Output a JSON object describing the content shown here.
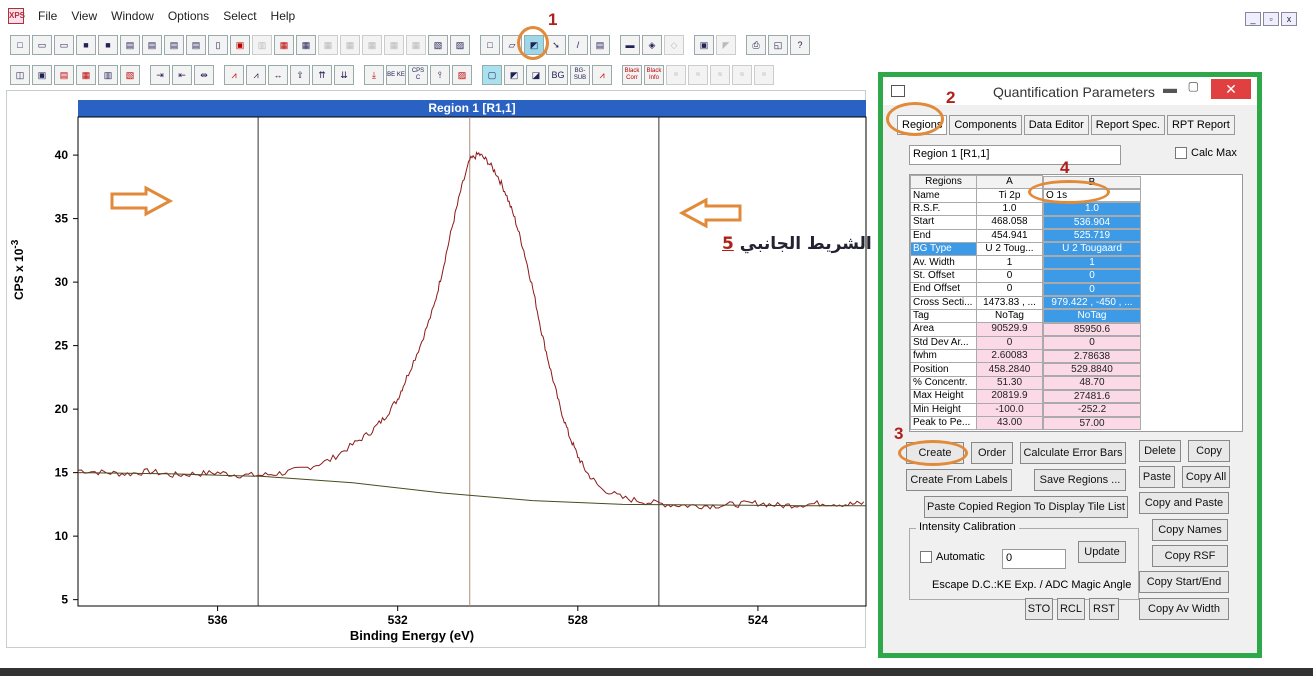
{
  "menu": [
    "File",
    "View",
    "Window",
    "Options",
    "Select",
    "Help"
  ],
  "app_icon_label": "XPS",
  "window_buttons": [
    "_",
    "▫",
    "x"
  ],
  "toolbar_badges": {
    "bk_cor": "Black Corr",
    "bk_info": "Black Info",
    "be": "BE KE",
    "cps": "CPS C",
    "bg_sub": "BG- SUB",
    "bg": "BG"
  },
  "annotations": {
    "n1": "1",
    "n2": "2",
    "n3": "3",
    "n4": "4",
    "n5": "5",
    "arabic_label": "الشريط الجانبي"
  },
  "plot": {
    "title": "Region 1 [R1,1]",
    "xlabel": "Binding Energy (eV)",
    "ylabel": "CPS x 10",
    "ylabel_exp": "-3"
  },
  "chart_data": {
    "type": "line",
    "title": "Region 1 [R1,1]",
    "xlabel": "Binding Energy (eV)",
    "ylabel": "CPS x 10-3",
    "xlim": [
      539.1,
      521.6
    ],
    "ylim": [
      4.5,
      43
    ],
    "x_ticks": [
      536,
      532,
      528,
      524
    ],
    "y_ticks": [
      5,
      10,
      15,
      20,
      25,
      30,
      35,
      40
    ],
    "region_lines": [
      535.1,
      530.4,
      526.2
    ],
    "series": [
      {
        "values_x": [
          539.1,
          538.5,
          538,
          537.5,
          537,
          536.5,
          536,
          535.5,
          535,
          534.5,
          534,
          533.5,
          533,
          532.6,
          532.3,
          532,
          531.8,
          531.5,
          531.2,
          531,
          530.8,
          530.6,
          530.4,
          530.2,
          530,
          529.8,
          529.6,
          529.4,
          529.2,
          529,
          528.8,
          528.6,
          528.4,
          528.2,
          528,
          527.8,
          527.5,
          527,
          526.5,
          526,
          525.5,
          525,
          524.5,
          524,
          523.5,
          523,
          522.5,
          522,
          521.6
        ],
        "values_y": [
          15.2,
          15.0,
          14.9,
          15.1,
          14.8,
          14.9,
          15.0,
          14.8,
          14.8,
          15.0,
          15.4,
          16.0,
          17.2,
          18.2,
          19.3,
          20.8,
          22.5,
          25.0,
          28.0,
          31.0,
          34.2,
          37.2,
          39.6,
          40.1,
          39.5,
          38.5,
          37.0,
          35.0,
          32.5,
          29.5,
          26.0,
          23.0,
          20.2,
          18.0,
          16.3,
          15.0,
          13.8,
          13.0,
          12.7,
          12.5,
          12.4,
          12.4,
          12.5,
          12.6,
          12.4,
          12.5,
          12.6,
          12.5,
          12.6
        ]
      },
      {
        "values_x": [
          539.1,
          537,
          535,
          533,
          531,
          529,
          527,
          525,
          523,
          521.6
        ],
        "values_y": [
          15.0,
          14.9,
          14.7,
          14.2,
          13.4,
          12.8,
          12.5,
          12.45,
          12.4,
          12.4
        ]
      }
    ]
  },
  "dialog": {
    "title": "Quantification Parameters",
    "tabs": [
      "Regions",
      "Components",
      "Data Editor",
      "Report Spec.",
      "RPT Report"
    ],
    "region_name": "Region 1 [R1,1]",
    "calc_max": "Calc Max",
    "table": {
      "headers": [
        "Regions",
        "A",
        "B"
      ],
      "rows": [
        {
          "label": "Name",
          "a": "Ti 2p",
          "b": "O 1s"
        },
        {
          "label": "R.S.F.",
          "a": "1.0",
          "b": "1.0"
        },
        {
          "label": "Start",
          "a": "468.058",
          "b": "536.904"
        },
        {
          "label": "End",
          "a": "454.941",
          "b": "525.719"
        },
        {
          "label": "BG Type",
          "a": "U 2 Toug...",
          "b": "U 2 Tougaard"
        },
        {
          "label": "Av. Width",
          "a": "1",
          "b": "1"
        },
        {
          "label": "St. Offset",
          "a": "0",
          "b": "0"
        },
        {
          "label": "End Offset",
          "a": "0",
          "b": "0"
        },
        {
          "label": "Cross Secti...",
          "a": "1473.83 , ...",
          "b": "979.422 , -450 , ..."
        },
        {
          "label": "Tag",
          "a": "NoTag",
          "b": "NoTag"
        },
        {
          "label": "Area",
          "a": "90529.9",
          "b": "85950.6"
        },
        {
          "label": "Std Dev Ar...",
          "a": "0",
          "b": "0"
        },
        {
          "label": "fwhm",
          "a": "2.60083",
          "b": "2.78638"
        },
        {
          "label": "Position",
          "a": "458.2840",
          "b": "529.8840"
        },
        {
          "label": "% Concentr.",
          "a": "51.30",
          "b": "48.70"
        },
        {
          "label": "Max Height",
          "a": "20819.9",
          "b": "27481.6"
        },
        {
          "label": "Min Height",
          "a": "-100.0",
          "b": "-252.2"
        },
        {
          "label": "Peak to Pe...",
          "a": "43.00",
          "b": "57.00"
        }
      ]
    },
    "buttons": {
      "create": "Create",
      "order": "Order",
      "calc_err": "Calculate Error Bars",
      "delete": "Delete",
      "copy": "Copy",
      "create_labels": "Create From Labels",
      "save_regions": "Save Regions ...",
      "paste": "Paste",
      "copy_all": "Copy All",
      "paste_copied": "Paste Copied Region To Display Tile List",
      "copy_paste": "Copy and Paste",
      "copy_names": "Copy Names",
      "copy_rsf": "Copy RSF",
      "copy_start_end": "Copy Start/End",
      "copy_av_width": "Copy Av Width",
      "sto": "STO",
      "rcl": "RCL",
      "rst": "RST",
      "update": "Update"
    },
    "intensity": {
      "legend": "Intensity Calibration",
      "automatic": "Automatic",
      "value": "0",
      "escape": "Escape D.C.:KE Exp. / ADC Magic Angle"
    }
  },
  "colors": {
    "title_bar_blue": "#2a62c4",
    "spectrum": "#8b1a1a",
    "background_curve": "#4a4a20",
    "dialog_border": "#2fa84a",
    "annotation_orange": "#e08a3a",
    "annotation_red": "#b0201a"
  }
}
